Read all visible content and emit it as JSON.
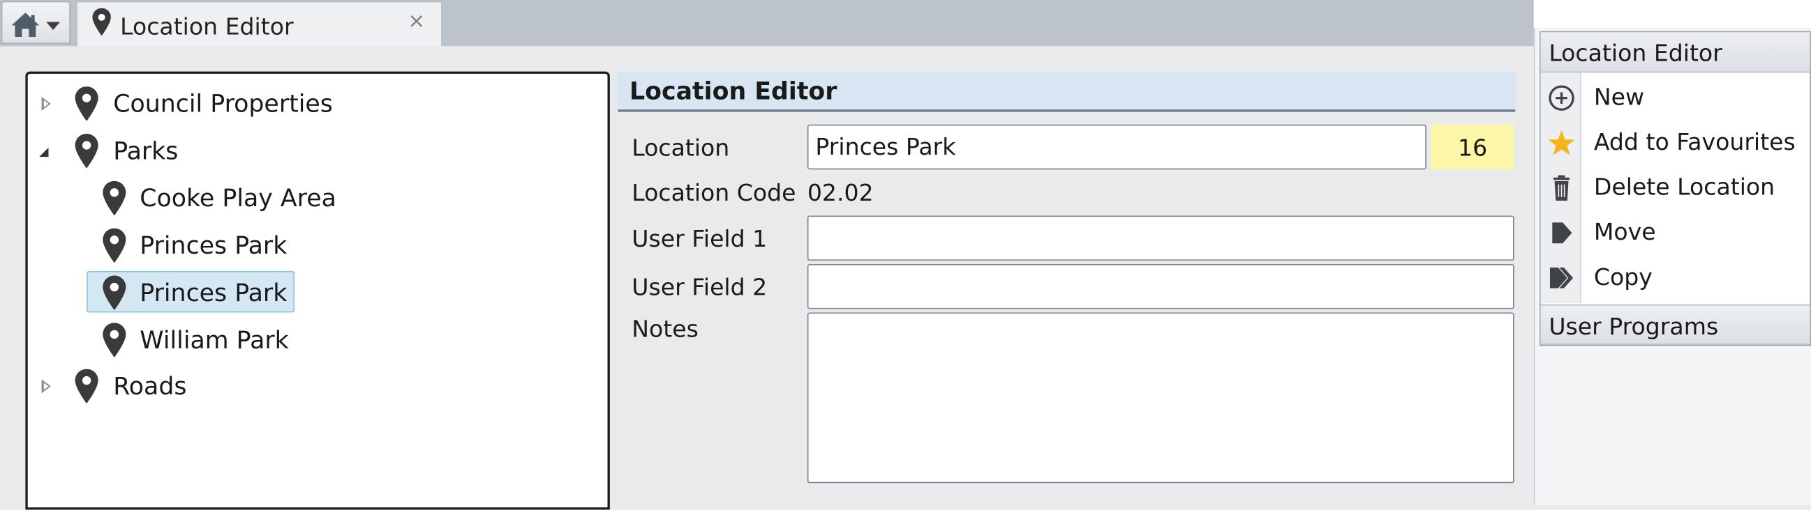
{
  "tabs": [
    {
      "label": "Location Editor",
      "close": "×"
    }
  ],
  "tree": {
    "items": [
      {
        "label": "Council Properties",
        "level": 0,
        "expander": "collapsed",
        "selected": false
      },
      {
        "label": "Parks",
        "level": 0,
        "expander": "expanded",
        "selected": false
      },
      {
        "label": "Cooke Play Area",
        "level": 1,
        "expander": "none",
        "selected": false
      },
      {
        "label": "Princes Park",
        "level": 1,
        "expander": "none",
        "selected": false
      },
      {
        "label": "Princes Park",
        "level": 1,
        "expander": "none",
        "selected": true
      },
      {
        "label": "William Park",
        "level": 1,
        "expander": "none",
        "selected": false
      },
      {
        "label": "Roads",
        "level": 0,
        "expander": "collapsed",
        "selected": false
      }
    ]
  },
  "editor": {
    "title": "Location Editor",
    "location_label": "Location",
    "location_value": "Princes Park",
    "location_badge": "16",
    "code_label": "Location Code",
    "code_value": "02.02",
    "user_field_1_label": "User Field 1",
    "user_field_1_value": "",
    "user_field_2_label": "User Field 2",
    "user_field_2_value": "",
    "notes_label": "Notes",
    "notes_value": ""
  },
  "right_panel": {
    "section_title": "Location Editor",
    "items": [
      {
        "label": "New",
        "icon": "plus-circle-icon"
      },
      {
        "label": "Add to Favourites",
        "icon": "star-icon"
      },
      {
        "label": "Delete Location",
        "icon": "trash-icon"
      },
      {
        "label": "Move",
        "icon": "move-arrow-icon"
      },
      {
        "label": "Copy",
        "icon": "copy-arrows-icon"
      }
    ],
    "section2_title": "User Programs"
  },
  "colors": {
    "badge": "#fbf6a8",
    "selection": "#d4e8f4",
    "header": "#d7e6f2",
    "star": "#f2b51c"
  }
}
